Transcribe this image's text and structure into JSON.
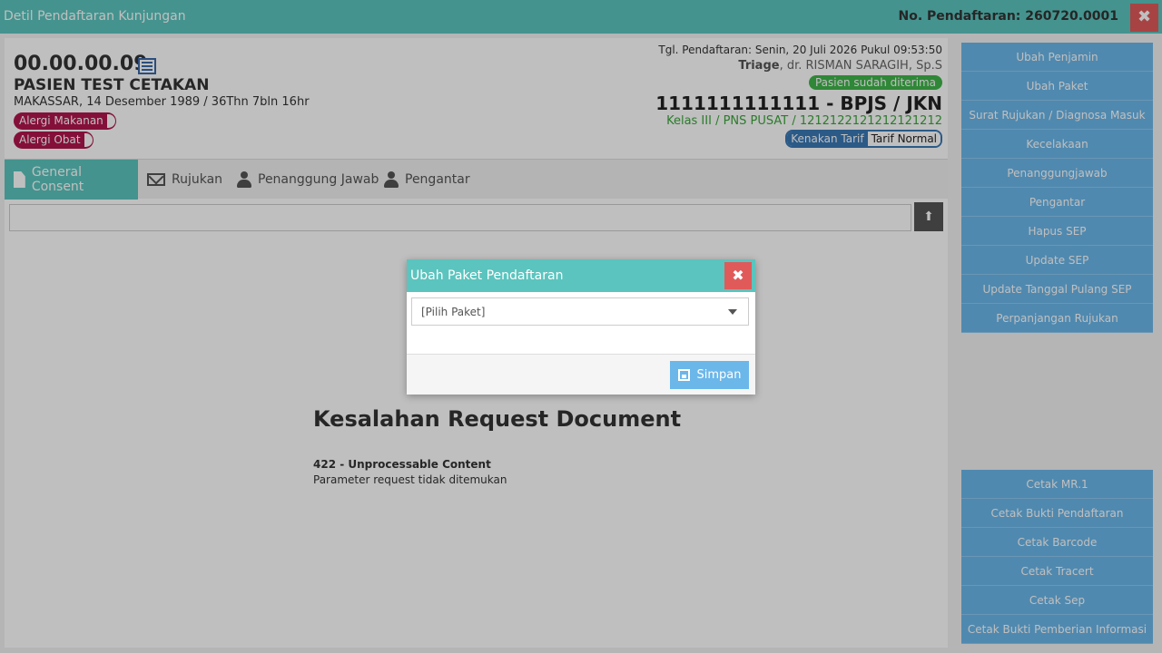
{
  "titlebar": {
    "title": "Detil Pendaftaran Kunjungan",
    "registration_no": "No. Pendaftaran: 260720.0001",
    "close_icon": "close-icon"
  },
  "patient": {
    "id": "00.00.00.09",
    "name": "PASIEN TEST CETAKAN",
    "birth": "MAKASSAR, 14 Desember 1989 / 36Thn 7bln 16hr",
    "allergies": [
      "Alergi Makanan",
      "Alergi Obat"
    ]
  },
  "registration": {
    "date": "Tgl. Pendaftaran: Senin, 20 Juli 2026 Pukul 09:53:50",
    "unit": "Triage",
    "doctor": ", dr. RISMAN SARAGIH, Sp.S",
    "status": "Pasien sudah diterima",
    "insurance": "1111111111111 - BPJS / JKN",
    "class": "Kelas III / PNS PUSAT / 1212122121212121212",
    "tarif_label": "Kenakan Tarif",
    "tarif_value": "Tarif Normal"
  },
  "tabs": [
    {
      "label": "General Consent",
      "icon": "document-icon"
    },
    {
      "label": "Rujukan",
      "icon": "envelope-icon"
    },
    {
      "label": "Penanggung Jawab",
      "icon": "user-icon"
    },
    {
      "label": "Pengantar",
      "icon": "user-icon"
    }
  ],
  "error": {
    "title": "Kesalahan Request Document",
    "code": "422 - Unprocessable Content",
    "message": "Parameter request tidak ditemukan"
  },
  "sidebar_top": [
    "Ubah Penjamin",
    "Ubah Paket",
    "Surat Rujukan / Diagnosa Masuk",
    "Kecelakaan",
    "Penanggungjawab",
    "Pengantar",
    "Hapus SEP",
    "Update SEP",
    "Update Tanggal Pulang SEP",
    "Perpanjangan Rujukan"
  ],
  "sidebar_bottom": [
    "Cetak MR.1",
    "Cetak Bukti Pendaftaran",
    "Cetak Barcode",
    "Cetak Tracert",
    "Cetak Sep",
    "Cetak Bukti Pemberian Informasi"
  ],
  "modal": {
    "title": "Ubah Paket Pendaftaran",
    "select_value": "[Pilih Paket]",
    "save_label": "Simpan"
  },
  "colors": {
    "accent": "#5bc4be",
    "danger": "#e05a5a",
    "primary": "#6bb7ea",
    "allergy": "#b0164c",
    "success": "#3fb54a"
  }
}
